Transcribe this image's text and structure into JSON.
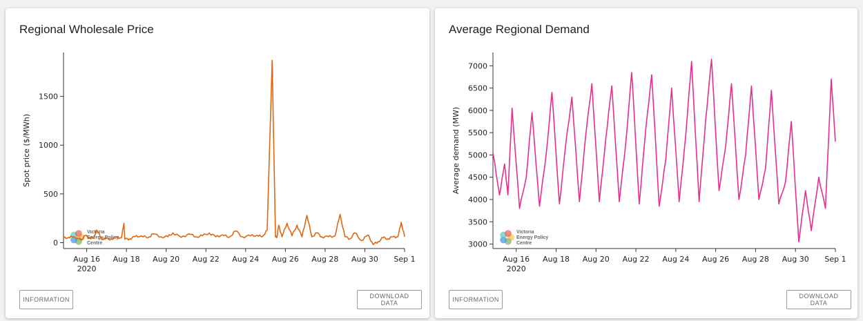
{
  "price_card": {
    "title": "Regional Wholesale Price",
    "info_label": "INFORMATION",
    "download_label": "DOWNLOAD DATA"
  },
  "demand_card": {
    "title": "Average Regional Demand",
    "info_label": "INFORMATION",
    "download_label": "DOWNLOAD DATA"
  },
  "logo": {
    "line1": "Victoria",
    "line2": "Energy Policy",
    "line3": "Centre"
  },
  "colors": {
    "price_line": "#e0650f",
    "demand_line": "#e52e8e"
  },
  "chart_data": [
    {
      "type": "line",
      "title": "Regional Wholesale Price",
      "ylabel": "Spot price ($/MWh)",
      "xlabel": "",
      "x_range": [
        "2020-08-14T20:00",
        "2020-09-01T00:00"
      ],
      "ylim": [
        -60,
        1950
      ],
      "yticks": [
        0,
        500,
        1000,
        1500
      ],
      "xticks": [
        {
          "date": "2020-08-16",
          "label": "Aug 16",
          "sublabel": "2020"
        },
        {
          "date": "2020-08-18",
          "label": "Aug 18"
        },
        {
          "date": "2020-08-20",
          "label": "Aug 20"
        },
        {
          "date": "2020-08-22",
          "label": "Aug 22"
        },
        {
          "date": "2020-08-24",
          "label": "Aug 24"
        },
        {
          "date": "2020-08-26",
          "label": "Aug 26"
        },
        {
          "date": "2020-08-28",
          "label": "Aug 28"
        },
        {
          "date": "2020-08-30",
          "label": "Aug 30"
        },
        {
          "date": "2020-09-01",
          "label": "Sep 1"
        }
      ],
      "grid": false,
      "series": [
        {
          "x": [
            "2020-08-14T20:00",
            "2020-08-15T02:00",
            "2020-08-15T08:00",
            "2020-08-15T14:00",
            "2020-08-15T18:00",
            "2020-08-15T22:00",
            "2020-08-16T04:00",
            "2020-08-16T08:00",
            "2020-08-16T12:00",
            "2020-08-16T18:00",
            "2020-08-16T22:00",
            "2020-08-17T06:00",
            "2020-08-17T12:00",
            "2020-08-17T18:00",
            "2020-08-17T21:00",
            "2020-08-17T22:00",
            "2020-08-18T04:00",
            "2020-08-18T10:00",
            "2020-08-18T18:00",
            "2020-08-19T02:00",
            "2020-08-19T08:00",
            "2020-08-19T18:00",
            "2020-08-20T02:00",
            "2020-08-20T08:00",
            "2020-08-20T18:00",
            "2020-08-21T04:00",
            "2020-08-21T12:00",
            "2020-08-21T20:00",
            "2020-08-22T04:00",
            "2020-08-22T12:00",
            "2020-08-22T20:00",
            "2020-08-23T04:00",
            "2020-08-23T12:00",
            "2020-08-23T20:00",
            "2020-08-24T06:00",
            "2020-08-24T14:00",
            "2020-08-24T20:00",
            "2020-08-25T02:00",
            "2020-08-25T08:00",
            "2020-08-25T12:00",
            "2020-08-25T14:00",
            "2020-08-25T16:00",
            "2020-08-25T20:00",
            "2020-08-26T02:00",
            "2020-08-26T08:00",
            "2020-08-26T14:00",
            "2020-08-26T20:00",
            "2020-08-27T02:00",
            "2020-08-27T08:00",
            "2020-08-27T14:00",
            "2020-08-27T20:00",
            "2020-08-28T04:00",
            "2020-08-28T12:00",
            "2020-08-28T18:00",
            "2020-08-29T00:00",
            "2020-08-29T06:00",
            "2020-08-29T12:00",
            "2020-08-29T20:00",
            "2020-08-30T04:00",
            "2020-08-30T10:00",
            "2020-08-30T16:00",
            "2020-08-30T22:00",
            "2020-08-31T04:00",
            "2020-08-31T10:00",
            "2020-08-31T16:00",
            "2020-08-31T20:00",
            "2020-09-01T00:00"
          ],
          "y": [
            45,
            55,
            60,
            40,
            35,
            70,
            50,
            45,
            130,
            40,
            35,
            40,
            55,
            50,
            200,
            35,
            40,
            60,
            70,
            50,
            90,
            60,
            60,
            100,
            55,
            90,
            60,
            70,
            100,
            60,
            80,
            55,
            120,
            60,
            70,
            75,
            60,
            130,
            1870,
            60,
            60,
            180,
            60,
            200,
            70,
            180,
            60,
            280,
            60,
            100,
            60,
            60,
            70,
            290,
            60,
            40,
            100,
            20,
            80,
            -20,
            10,
            50,
            40,
            60,
            60,
            210,
            60
          ]
        }
      ]
    },
    {
      "type": "line",
      "title": "Average Regional Demand",
      "ylabel": "Average demand (MW)",
      "xlabel": "",
      "x_range": [
        "2020-08-14T20:00",
        "2020-09-01T00:00"
      ],
      "ylim": [
        2900,
        7300
      ],
      "yticks": [
        3000,
        3500,
        4000,
        4500,
        5000,
        5500,
        6000,
        6500,
        7000
      ],
      "xticks": [
        {
          "date": "2020-08-16",
          "label": "Aug 16",
          "sublabel": "2020"
        },
        {
          "date": "2020-08-18",
          "label": "Aug 18"
        },
        {
          "date": "2020-08-20",
          "label": "Aug 20"
        },
        {
          "date": "2020-08-22",
          "label": "Aug 22"
        },
        {
          "date": "2020-08-24",
          "label": "Aug 24"
        },
        {
          "date": "2020-08-26",
          "label": "Aug 26"
        },
        {
          "date": "2020-08-28",
          "label": "Aug 28"
        },
        {
          "date": "2020-08-30",
          "label": "Aug 30"
        },
        {
          "date": "2020-09-01",
          "label": "Sep 1"
        }
      ],
      "grid": false,
      "series": [
        {
          "x": [
            "2020-08-14T20:00",
            "2020-08-15T04:00",
            "2020-08-15T10:00",
            "2020-08-15T14:00",
            "2020-08-15T19:00",
            "2020-08-16T04:00",
            "2020-08-16T12:00",
            "2020-08-16T19:00",
            "2020-08-17T04:00",
            "2020-08-17T12:00",
            "2020-08-17T19:00",
            "2020-08-18T04:00",
            "2020-08-18T12:00",
            "2020-08-18T19:00",
            "2020-08-19T04:00",
            "2020-08-19T12:00",
            "2020-08-19T19:00",
            "2020-08-20T04:00",
            "2020-08-20T12:00",
            "2020-08-20T19:00",
            "2020-08-21T04:00",
            "2020-08-21T12:00",
            "2020-08-21T19:00",
            "2020-08-22T04:00",
            "2020-08-22T12:00",
            "2020-08-22T19:00",
            "2020-08-23T04:00",
            "2020-08-23T12:00",
            "2020-08-23T19:00",
            "2020-08-24T04:00",
            "2020-08-24T12:00",
            "2020-08-24T19:00",
            "2020-08-25T04:00",
            "2020-08-25T12:00",
            "2020-08-25T19:00",
            "2020-08-26T04:00",
            "2020-08-26T12:00",
            "2020-08-26T19:00",
            "2020-08-27T04:00",
            "2020-08-27T12:00",
            "2020-08-27T19:00",
            "2020-08-28T04:00",
            "2020-08-28T12:00",
            "2020-08-28T19:00",
            "2020-08-29T04:00",
            "2020-08-29T12:00",
            "2020-08-29T19:00",
            "2020-08-30T04:00",
            "2020-08-30T12:00",
            "2020-08-30T19:00",
            "2020-08-31T04:00",
            "2020-08-31T12:00",
            "2020-08-31T19:00",
            "2020-09-01T00:00"
          ],
          "y": [
            5050,
            4100,
            4800,
            4100,
            6050,
            3800,
            4500,
            5950,
            3850,
            5000,
            6400,
            3900,
            5300,
            6300,
            3950,
            5500,
            6600,
            3950,
            5400,
            6550,
            3950,
            5300,
            6850,
            3900,
            5600,
            6800,
            3850,
            4900,
            6500,
            3950,
            5450,
            7100,
            3950,
            5800,
            7150,
            4200,
            5200,
            6600,
            4000,
            5000,
            6550,
            4000,
            4700,
            6450,
            3900,
            4400,
            5750,
            3050,
            4200,
            3300,
            4500,
            3800,
            6700,
            5300
          ]
        }
      ]
    }
  ]
}
